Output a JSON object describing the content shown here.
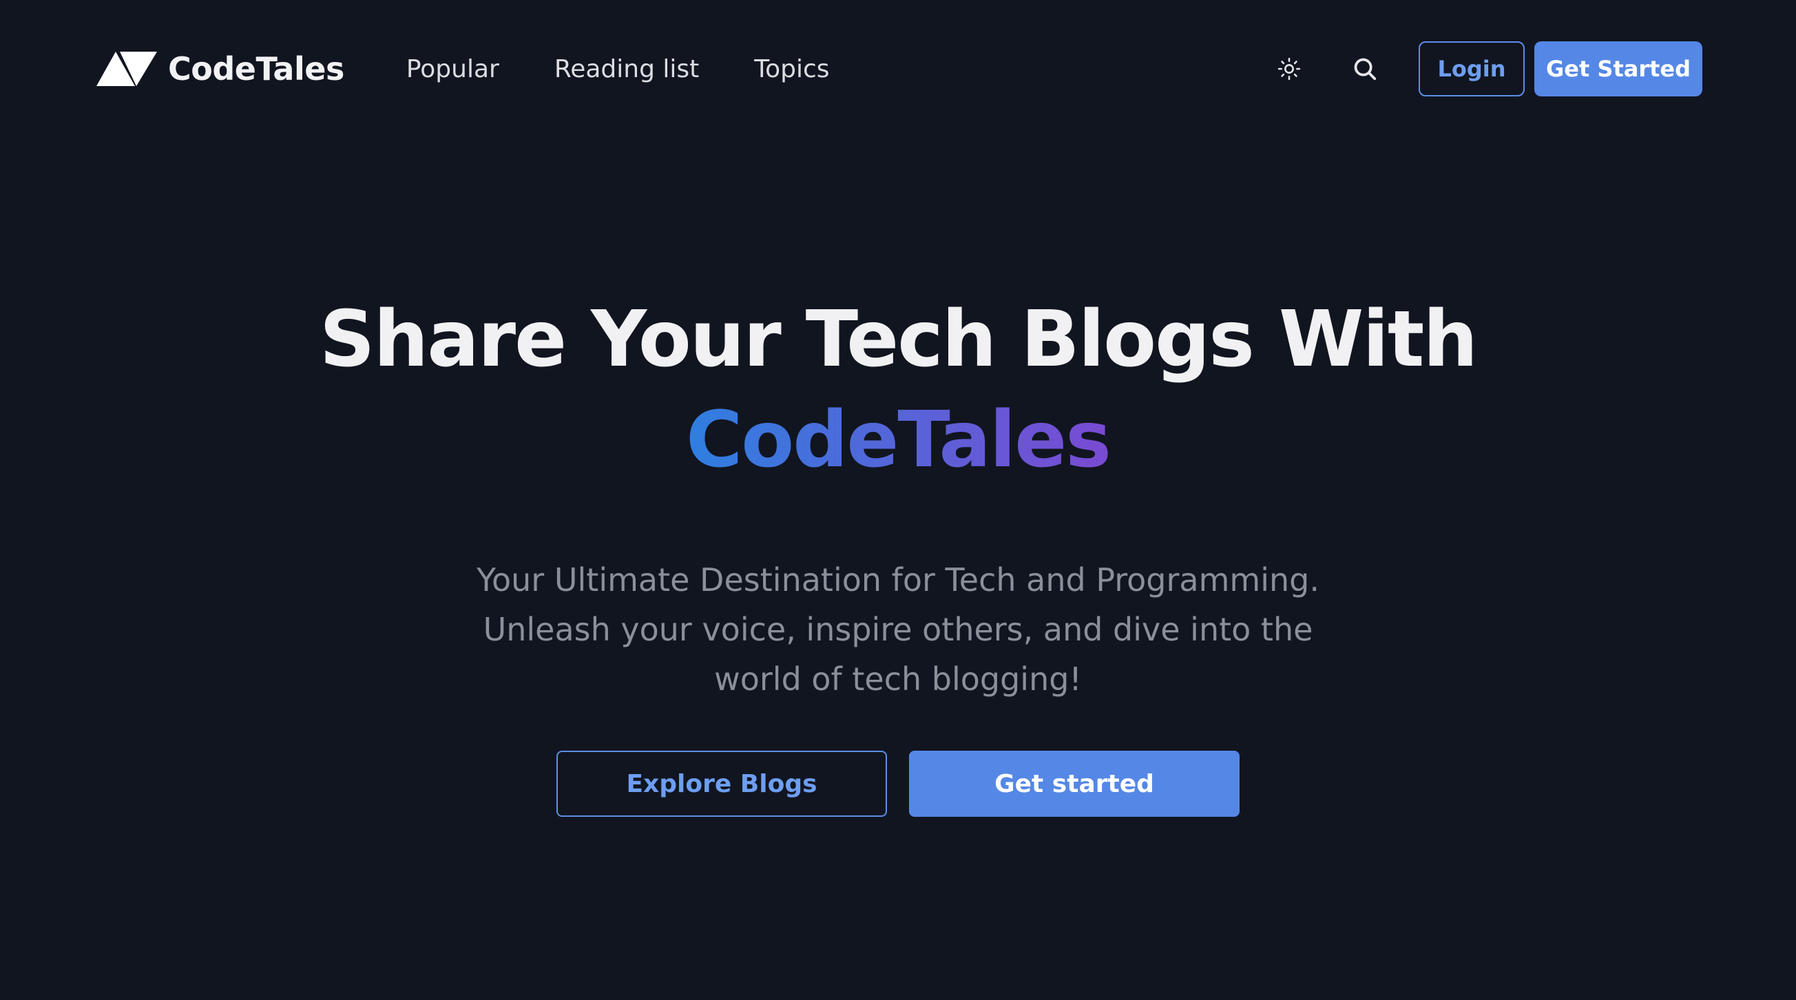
{
  "nav": {
    "brand": "CodeTales",
    "links": [
      {
        "label": "Popular"
      },
      {
        "label": "Reading list"
      },
      {
        "label": "Topics"
      }
    ],
    "icons": {
      "theme": "sun-icon",
      "search": "search-icon"
    },
    "login_label": "Login",
    "get_started_label": "Get Started"
  },
  "hero": {
    "title_line1": "Share Your Tech Blogs With",
    "title_line2": "CodeTales",
    "subtitle": "Your Ultimate Destination for Tech and Programming. Unleash your voice, inspire others, and dive into the world of tech blogging!",
    "explore_label": "Explore Blogs",
    "get_started_label": "Get started"
  },
  "colors": {
    "background": "#111520",
    "accent": "#5587e6",
    "gradient_start": "#2f7fe0",
    "gradient_end": "#7a4ad2",
    "muted_text": "#8b8f9a"
  }
}
